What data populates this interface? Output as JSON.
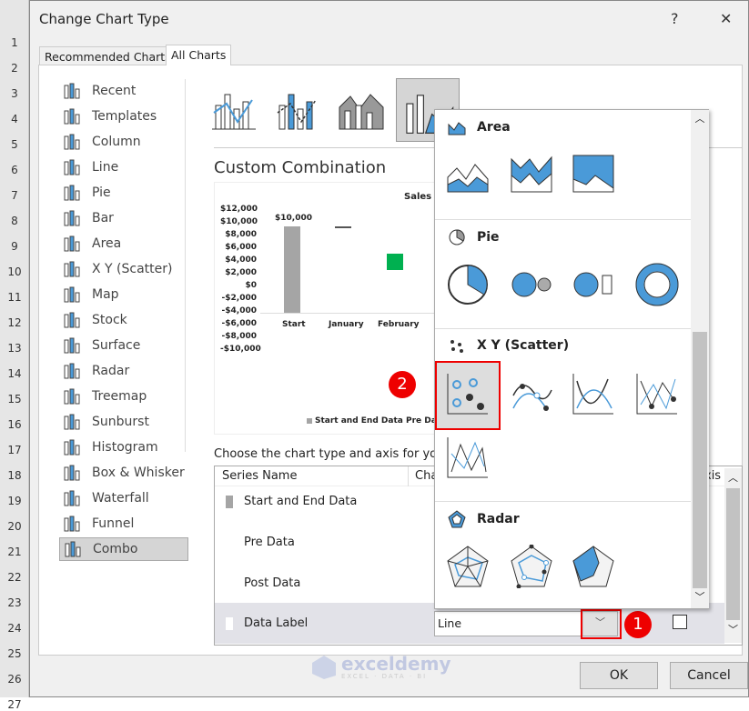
{
  "row_numbers": [
    "1",
    "2",
    "3",
    "4",
    "5",
    "6",
    "7",
    "8",
    "9",
    "10",
    "11",
    "12",
    "13",
    "14",
    "15",
    "16",
    "17",
    "18",
    "19",
    "20",
    "21",
    "22",
    "23",
    "24",
    "25",
    "26",
    "27"
  ],
  "dialog": {
    "title": "Change Chart Type",
    "help": "?",
    "close": "✕",
    "tabs": [
      {
        "label": "Recommended Charts"
      },
      {
        "label": "All Charts",
        "active": true
      }
    ],
    "sidebar": [
      {
        "label": "Recent",
        "icon": "recent-icon"
      },
      {
        "label": "Templates",
        "icon": "templates-icon"
      },
      {
        "label": "Column",
        "icon": "column-chart-icon"
      },
      {
        "label": "Line",
        "icon": "line-chart-icon"
      },
      {
        "label": "Pie",
        "icon": "pie-chart-icon"
      },
      {
        "label": "Bar",
        "icon": "bar-chart-icon"
      },
      {
        "label": "Area",
        "icon": "area-chart-icon"
      },
      {
        "label": "X Y (Scatter)",
        "icon": "scatter-chart-icon"
      },
      {
        "label": "Map",
        "icon": "map-chart-icon"
      },
      {
        "label": "Stock",
        "icon": "stock-chart-icon"
      },
      {
        "label": "Surface",
        "icon": "surface-chart-icon"
      },
      {
        "label": "Radar",
        "icon": "radar-chart-icon"
      },
      {
        "label": "Treemap",
        "icon": "treemap-chart-icon"
      },
      {
        "label": "Sunburst",
        "icon": "sunburst-chart-icon"
      },
      {
        "label": "Histogram",
        "icon": "histogram-chart-icon"
      },
      {
        "label": "Box & Whisker",
        "icon": "box-whisker-icon"
      },
      {
        "label": "Waterfall",
        "icon": "waterfall-chart-icon"
      },
      {
        "label": "Funnel",
        "icon": "funnel-chart-icon"
      },
      {
        "label": "Combo",
        "icon": "combo-chart-icon",
        "selected": true
      }
    ],
    "section_title": "Custom Combination",
    "preview": {
      "title": "Sales I",
      "y_ticks": [
        "$12,000",
        "$10,000",
        "$8,000",
        "$6,000",
        "$4,000",
        "$2,000",
        "$0",
        "-$2,000",
        "-$4,000",
        "-$6,000",
        "-$8,000",
        "-$10,000"
      ],
      "categories": [
        "Start",
        "January",
        "February"
      ],
      "data_label": "$10,000",
      "legend": [
        "Start and End Data",
        "Pre Da"
      ],
      "colors": {
        "start": "#a5a5a5",
        "february": "#00b050"
      }
    },
    "choose_text": "Choose the chart type and axis for your c",
    "table": {
      "headers": [
        "Series Name",
        "Cha",
        "xis"
      ],
      "rows": [
        {
          "name": "Start and End Data",
          "color": "#a5a5a5"
        },
        {
          "name": "Pre Data"
        },
        {
          "name": "Post Data"
        },
        {
          "name": "Data Label",
          "color": "#ffffff",
          "chart_type": "Line",
          "selected": true
        }
      ]
    },
    "popup": {
      "sections": [
        {
          "label": "Area"
        },
        {
          "label": "Pie"
        },
        {
          "label": "X Y (Scatter)"
        },
        {
          "label": "Radar"
        }
      ]
    },
    "badges": [
      "1",
      "2"
    ],
    "ok": "OK",
    "cancel": "Cancel",
    "watermark": {
      "name": "exceldemy",
      "tagline": "EXCEL · DATA · BI"
    },
    "accent": "#4a9ad8",
    "highlight": "#e00000"
  }
}
